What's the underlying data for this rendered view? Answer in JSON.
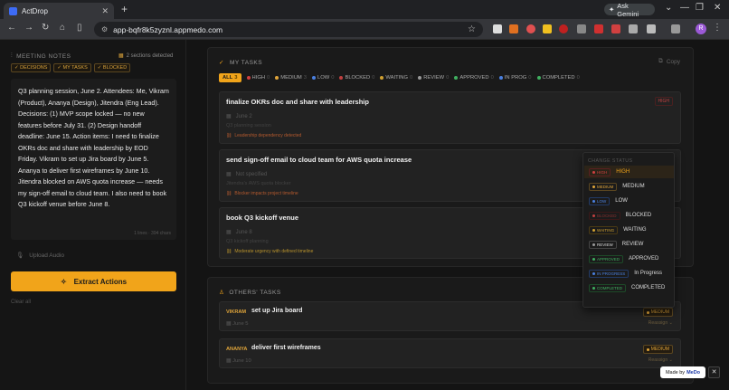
{
  "browser": {
    "tab_title": "ActDrop",
    "url": "app-bqfr8k5zyznl.appmedo.com",
    "gemini_label": "Ask Gemini",
    "profile_initial": "R"
  },
  "left": {
    "header": "MEETING NOTES",
    "detected": "2 sections detected",
    "chips": [
      "DECISIONS",
      "MY TASKS",
      "BLOCKED"
    ],
    "notes": "Q3 planning session, June 2. Attendees: Me, Vikram (Product), Ananya (Design), Jitendra (Eng Lead). Decisions: (1) MVP scope locked — no new features before July 31. (2) Design handoff deadline: June 15. Action items: I need to finalize OKRs doc and share with leadership by EOD Friday. Vikram to set up Jira board by June 5. Ananya to deliver first wireframes by June 10. Jitendra blocked on AWS quota increase — needs my sign-off email to cloud team. I also need to book Q3 kickoff venue before June 8.",
    "notes_count": "1 lines · 394 chars",
    "upload_label": "Upload Audio",
    "extract_label": "Extract Actions",
    "clear_label": "Clear all"
  },
  "my_tasks": {
    "header": "MY TASKS",
    "copy_label": "Copy",
    "filters": [
      {
        "label": "ALL",
        "count": "3",
        "color": "#f1a41a",
        "active": true
      },
      {
        "label": "HIGH",
        "count": "0",
        "color": "#d04040"
      },
      {
        "label": "MEDIUM",
        "count": "3",
        "color": "#e0a53a"
      },
      {
        "label": "LOW",
        "count": "0",
        "color": "#4a80e0"
      },
      {
        "label": "BLOCKED",
        "count": "0",
        "color": "#c04040"
      },
      {
        "label": "WAITING",
        "count": "0",
        "color": "#d0a030"
      },
      {
        "label": "REVIEW",
        "count": "0",
        "color": "#9a9a9a"
      },
      {
        "label": "APPROVED",
        "count": "0",
        "color": "#40b060"
      },
      {
        "label": "IN PROG",
        "count": "0",
        "color": "#4a80e0"
      },
      {
        "label": "COMPLETED",
        "count": "0",
        "color": "#40b060"
      }
    ],
    "tasks": [
      {
        "title": "finalize OKRs doc and share with leadership",
        "date": "June 2",
        "source": "Q3 planning session",
        "note": "Leadership dependency detected",
        "note_color": "orange",
        "priority": "HIGH"
      },
      {
        "title": "send sign-off email to cloud team for AWS quota increase",
        "date": "Not specified",
        "source": "Jitendra's AWS quota blocker",
        "note": "Blocker impacts project timeline",
        "note_color": "orange"
      },
      {
        "title": "book Q3 kickoff venue",
        "date": "June 8",
        "source": "Q3 kickoff planning",
        "note": "Moderate urgency with defined timeline",
        "note_color": "amber"
      }
    ]
  },
  "status_menu": {
    "header": "CHANGE STATUS",
    "options": [
      {
        "badge": "HIGH",
        "label": "HIGH",
        "color": "#d04040",
        "selected": true
      },
      {
        "badge": "MEDIUM",
        "label": "MEDIUM",
        "color": "#e0a53a"
      },
      {
        "badge": "LOW",
        "label": "LOW",
        "color": "#4a80e0"
      },
      {
        "badge": "BLOCKED",
        "label": "BLOCKED",
        "color": "#c04040"
      },
      {
        "badge": "WAITING",
        "label": "WAITING",
        "color": "#d0a030"
      },
      {
        "badge": "REVIEW",
        "label": "REVIEW",
        "color": "#9a9a9a"
      },
      {
        "badge": "APPROVED",
        "label": "APPROVED",
        "color": "#40b060"
      },
      {
        "badge": "IN PROGRESS",
        "label": "In Progress",
        "color": "#4a80e0"
      },
      {
        "badge": "COMPLETED",
        "label": "COMPLETED",
        "color": "#40b060"
      }
    ]
  },
  "others": {
    "header": "OTHERS' TASKS",
    "tasks": [
      {
        "who": "VIKRAM",
        "title": "set up Jira board",
        "date": "June 5",
        "badge": "MEDIUM",
        "reassign": "Reassign ⌄"
      },
      {
        "who": "ANANYA",
        "title": "deliver first wireframes",
        "date": "June 10",
        "badge": "MEDIUM",
        "reassign": "Reassign ⌄"
      }
    ]
  },
  "made_with": {
    "prefix": "Made by",
    "brand": "MeDo"
  }
}
